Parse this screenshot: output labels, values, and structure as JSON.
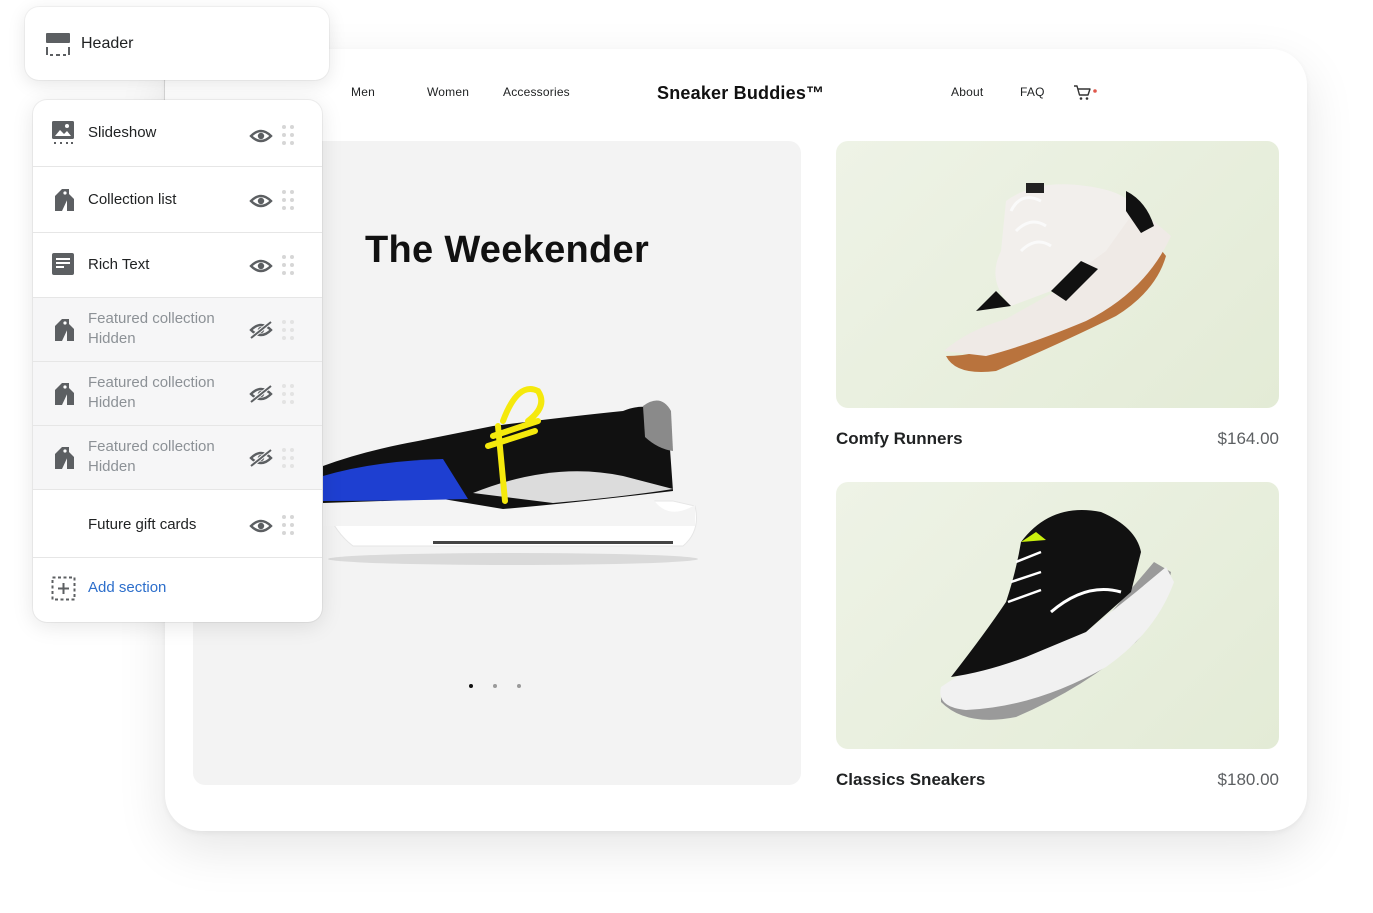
{
  "storefront": {
    "nav_left": [
      "Men",
      "Women",
      "Accessories"
    ],
    "brand": "Sneaker Buddies™",
    "nav_right": [
      "About",
      "FAQ"
    ],
    "hero": {
      "title": "The Weekender",
      "slide_count": 3,
      "active_slide": 1
    },
    "products": [
      {
        "name": "Comfy Runners",
        "price": "$164.00"
      },
      {
        "name": "Classics Sneakers",
        "price": "$180.00"
      }
    ]
  },
  "editor": {
    "header_label": "Header",
    "sections": [
      {
        "label": "Slideshow",
        "sub": "",
        "icon": "image-icon",
        "hidden": false
      },
      {
        "label": "Collection list",
        "sub": "",
        "icon": "tag-icon",
        "hidden": false
      },
      {
        "label": "Rich Text",
        "sub": "",
        "icon": "text-block-icon",
        "hidden": false
      },
      {
        "label": "Featured collection",
        "sub": "Hidden",
        "icon": "tag-icon",
        "hidden": true
      },
      {
        "label": "Featured collection",
        "sub": "Hidden",
        "icon": "tag-icon",
        "hidden": true
      },
      {
        "label": "Featured collection",
        "sub": "Hidden",
        "icon": "tag-icon",
        "hidden": true
      },
      {
        "label": "Future gift cards",
        "sub": "",
        "icon": "",
        "hidden": false
      }
    ],
    "add_section_label": "Add section"
  },
  "colors": {
    "link": "#2c6ecb",
    "icon": "#5c5f62",
    "hidden_text": "#8c9196",
    "accent_dot": "#e0584c"
  }
}
